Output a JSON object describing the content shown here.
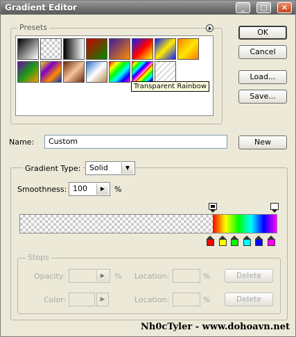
{
  "window": {
    "title": "Gradient Editor"
  },
  "buttons": {
    "ok": "OK",
    "cancel": "Cancel",
    "load": "Load...",
    "save": "Save...",
    "new": "New",
    "delete1": "Delete",
    "delete2": "Delete"
  },
  "presets": {
    "legend": "Presets",
    "menu_icon": "circle-arrow-icon",
    "tooltip": "Transparent Rainbow",
    "items": [
      "black-white",
      "transparent-checker",
      "black-white-alt",
      "red-green",
      "purple-orange",
      "blue-red-yellow",
      "blue-yellow-blue",
      "orange-yellow-orange",
      "violet-orange",
      "yellow-violet-orange-blue",
      "copper",
      "chrome",
      "spectrum",
      "transparent-rainbow",
      "transparent-stripes"
    ]
  },
  "name": {
    "label": "Name:",
    "value": "Custom"
  },
  "gradient": {
    "type_label": "Gradient Type:",
    "type_value": "Solid",
    "smooth_label": "Smoothness:",
    "smooth_value": "100",
    "smooth_unit": "%"
  },
  "stops": {
    "legend": "Stops",
    "opacity_label": "Opacity:",
    "opacity_unit": "%",
    "location_label": "Location:",
    "location_unit": "%",
    "color_label": "Color:",
    "color_stops": [
      "#ff0000",
      "#ffff00",
      "#00ff00",
      "#00ffff",
      "#0000ff",
      "#ff00ff"
    ]
  },
  "watermark": "Nh0cTyler - www.dohoavn.net"
}
